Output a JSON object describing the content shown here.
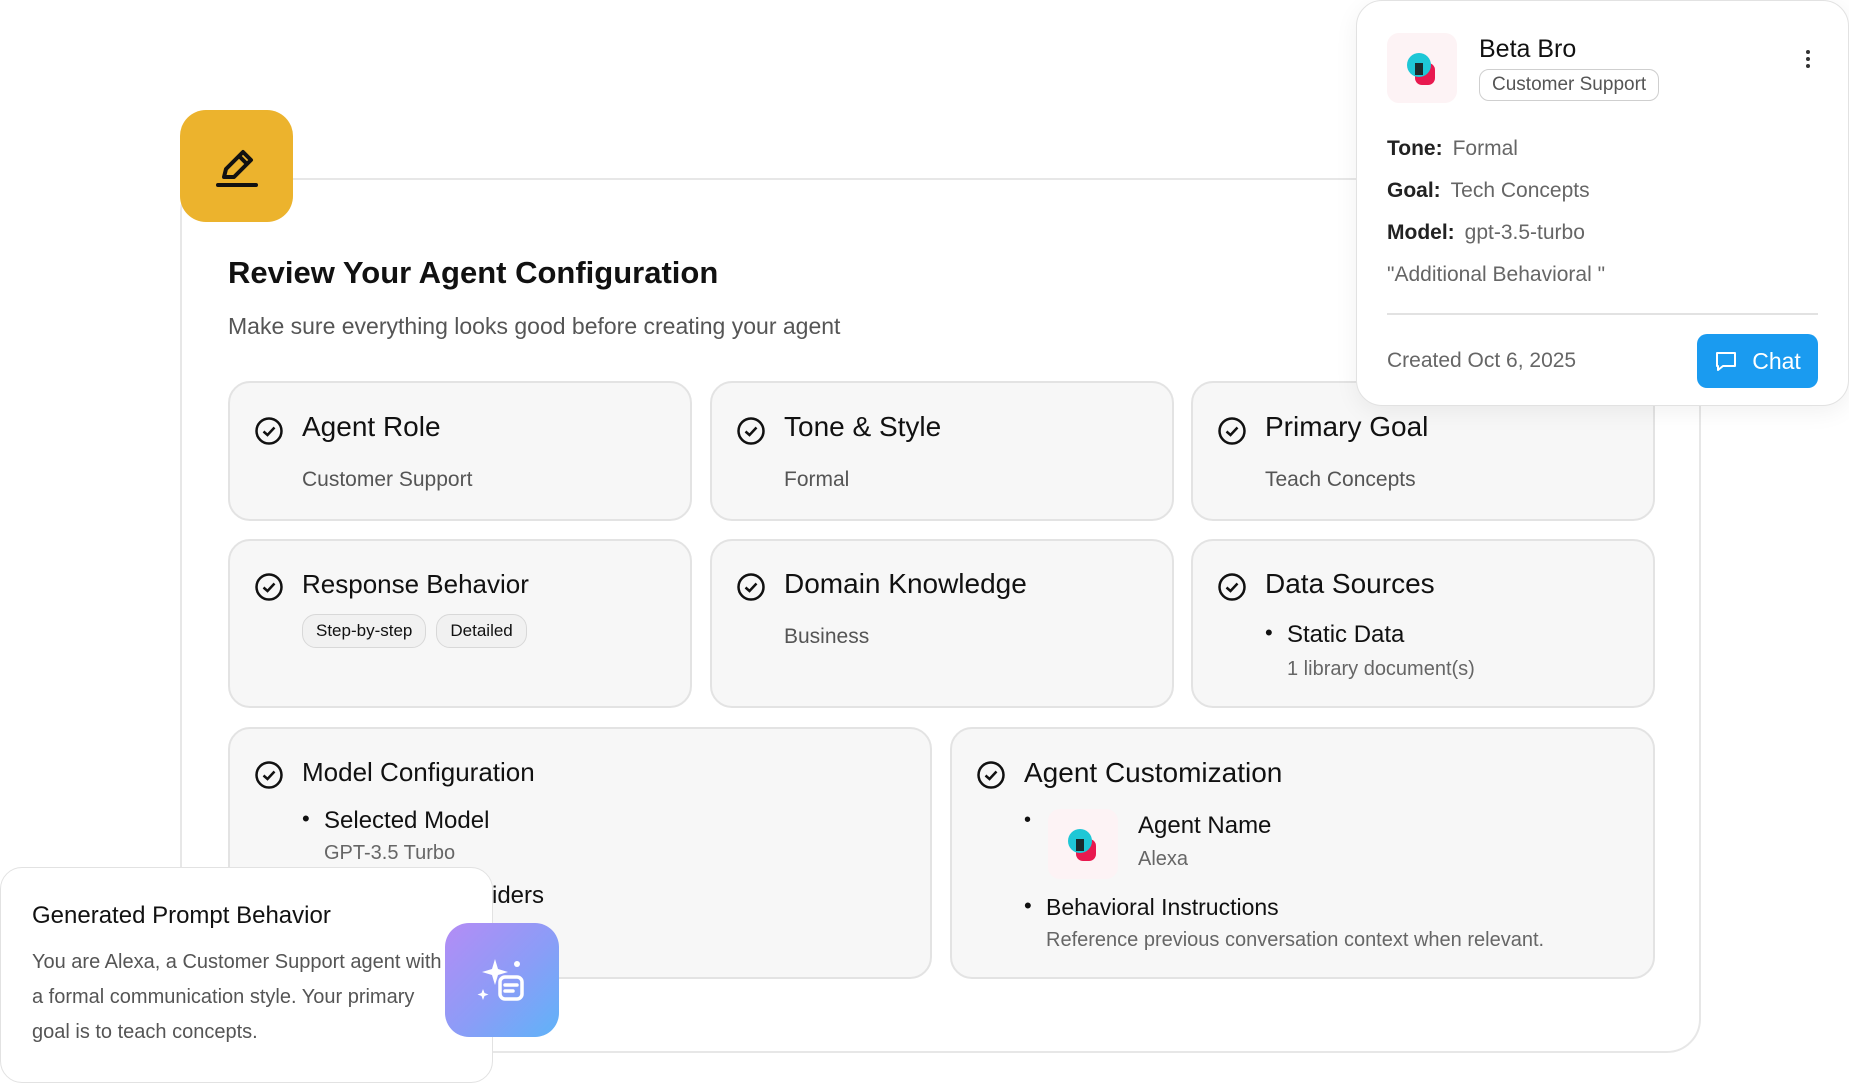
{
  "header": {
    "title": "Review Your Agent Configuration",
    "subtitle": "Make sure everything looks good before creating your agent"
  },
  "cards": {
    "agent_role": {
      "title": "Agent Role",
      "value": "Customer Support"
    },
    "tone_style": {
      "title": "Tone & Style",
      "value": "Formal"
    },
    "primary_goal": {
      "title": "Primary Goal",
      "value": "Teach Concepts"
    },
    "response_behavior": {
      "title": "Response Behavior",
      "chips": [
        "Step-by-step",
        "Detailed"
      ]
    },
    "domain_knowledge": {
      "title": "Domain Knowledge",
      "value": "Business"
    },
    "data_sources": {
      "title": "Data Sources",
      "item": "Static Data",
      "detail": "1 library document(s)"
    },
    "model_configuration": {
      "title": "Model Configuration",
      "item": "Selected Model",
      "detail": "GPT-3.5 Turbo",
      "partial": "viders"
    },
    "agent_customization": {
      "title": "Agent Customization",
      "name_label": "Agent Name",
      "name_value": "Alexa",
      "instructions_label": "Behavioral Instructions",
      "instructions_value": "Reference previous conversation context when relevant."
    }
  },
  "popup": {
    "name": "Beta Bro",
    "tag": "Customer Support",
    "tone_label": "Tone:",
    "tone_value": "Formal",
    "goal_label": "Goal:",
    "goal_value": "Tech Concepts",
    "model_label": "Model:",
    "model_value": "gpt-3.5-turbo",
    "extra": "\"Additional Behavioral \"",
    "created": "Created Oct 6, 2025",
    "chat_label": "Chat"
  },
  "prompt": {
    "title": "Generated Prompt Behavior",
    "text": "You are Alexa, a Customer Support agent with a formal communication style. Your primary goal is to teach concepts."
  },
  "colors": {
    "accent_blue": "#1a9bf0",
    "edit_badge": "#ecb32d",
    "card_bg": "#f7f7f7"
  },
  "icons": [
    "edit-icon",
    "check-circle-icon",
    "chat-icon",
    "sparkle-icon",
    "kebab-menu-icon",
    "beta-logo"
  ]
}
